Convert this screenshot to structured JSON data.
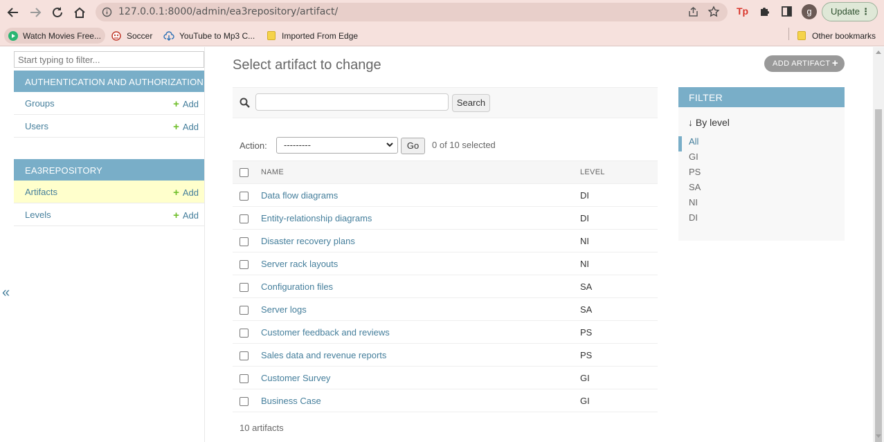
{
  "browser": {
    "url": "127.0.0.1:8000/admin/ea3repository/artifact/",
    "profile_initial": "g",
    "update_label": "Update",
    "update_menu": "⋮",
    "ext_label": "Tp"
  },
  "bookmarks": {
    "items": [
      {
        "label": "Watch Movies Free..."
      },
      {
        "label": "Soccer"
      },
      {
        "label": "YouTube to Mp3 C..."
      },
      {
        "label": "Imported From Edge"
      }
    ],
    "other": "Other bookmarks"
  },
  "sidebar": {
    "filter_placeholder": "Start typing to filter...",
    "modules": [
      {
        "caption": "AUTHENTICATION AND AUTHORIZATION",
        "rows": [
          {
            "label": "Groups",
            "add": "Add"
          },
          {
            "label": "Users",
            "add": "Add"
          }
        ]
      },
      {
        "caption": "EA3REPOSITORY",
        "rows": [
          {
            "label": "Artifacts",
            "add": "Add"
          },
          {
            "label": "Levels",
            "add": "Add"
          }
        ]
      }
    ],
    "collapse_symbol": "«"
  },
  "content": {
    "title": "Select artifact to change",
    "add_button": "ADD ARTIFACT",
    "search_button": "Search",
    "action_label": "Action:",
    "action_selected": "---------",
    "go_button": "Go",
    "selected_count": "0 of 10 selected",
    "columns": {
      "name": "NAME",
      "level": "LEVEL"
    },
    "rows": [
      {
        "name": "Data flow diagrams",
        "level": "DI"
      },
      {
        "name": "Entity-relationship diagrams",
        "level": "DI"
      },
      {
        "name": "Disaster recovery plans",
        "level": "NI"
      },
      {
        "name": "Server rack layouts",
        "level": "NI"
      },
      {
        "name": "Configuration files",
        "level": "SA"
      },
      {
        "name": "Server logs",
        "level": "SA"
      },
      {
        "name": "Customer feedback and reviews",
        "level": "PS"
      },
      {
        "name": "Sales data and revenue reports",
        "level": "PS"
      },
      {
        "name": "Customer Survey",
        "level": "GI"
      },
      {
        "name": "Business Case",
        "level": "GI"
      }
    ],
    "paginator": "10 artifacts"
  },
  "filter": {
    "caption": "FILTER",
    "by_label": "↓ By level",
    "options": [
      "All",
      "GI",
      "PS",
      "SA",
      "NI",
      "DI"
    ],
    "selected": "All"
  },
  "colors": {
    "module_caption": "#79aec8",
    "link": "#447e9b",
    "add_plus": "#70bf2b",
    "current_row": "#ffffcc",
    "chrome": "#f6e1dd"
  }
}
